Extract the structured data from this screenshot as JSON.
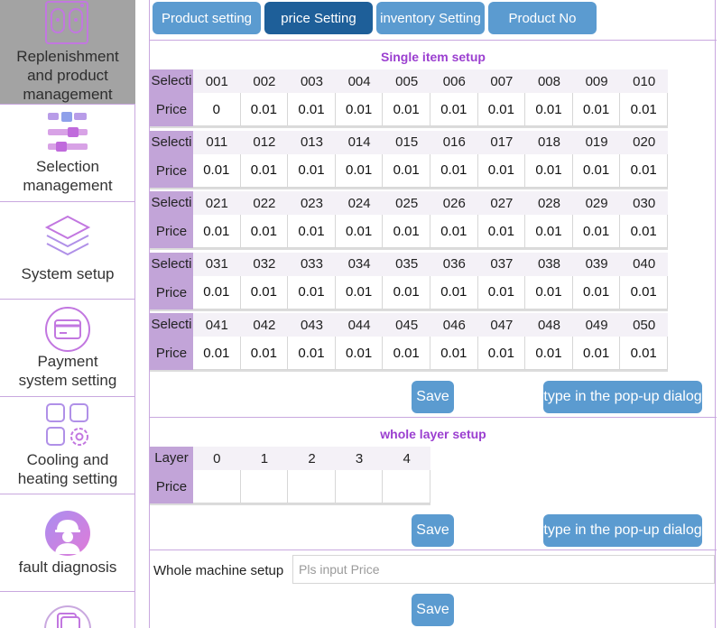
{
  "sidebar": {
    "items": [
      {
        "label_lines": [
          "Replenishment",
          "and product",
          "management"
        ],
        "icon": "cabinet-icon",
        "active": true
      },
      {
        "label_lines": [
          "Selection",
          "management"
        ],
        "icon": "sliders-icon",
        "active": false
      },
      {
        "label_lines": [
          "System setup"
        ],
        "icon": "layers-icon",
        "active": false
      },
      {
        "label_lines": [
          "Payment",
          "system setting"
        ],
        "icon": "card-icon",
        "active": false
      },
      {
        "label_lines": [
          "Cooling and",
          "heating setting"
        ],
        "icon": "grid-gear-icon",
        "active": false
      },
      {
        "label_lines": [
          "fault diagnosis"
        ],
        "icon": "worker-icon",
        "active": false
      },
      {
        "label_lines": [],
        "icon": "document-icon",
        "active": false
      }
    ]
  },
  "tabs": [
    {
      "label": "Product setting",
      "active": false
    },
    {
      "label": "price Setting",
      "active": true
    },
    {
      "label": "inventory Setting",
      "active": false
    },
    {
      "label": "Product No",
      "active": false
    }
  ],
  "single_item": {
    "title": "Single item setup",
    "selection_label": "Selecti",
    "price_label": "Price",
    "rows": [
      {
        "selections": [
          "001",
          "002",
          "003",
          "004",
          "005",
          "006",
          "007",
          "008",
          "009",
          "010"
        ],
        "prices": [
          "0",
          "0.01",
          "0.01",
          "0.01",
          "0.01",
          "0.01",
          "0.01",
          "0.01",
          "0.01",
          "0.01"
        ]
      },
      {
        "selections": [
          "011",
          "012",
          "013",
          "014",
          "015",
          "016",
          "017",
          "018",
          "019",
          "020"
        ],
        "prices": [
          "0.01",
          "0.01",
          "0.01",
          "0.01",
          "0.01",
          "0.01",
          "0.01",
          "0.01",
          "0.01",
          "0.01"
        ]
      },
      {
        "selections": [
          "021",
          "022",
          "023",
          "024",
          "025",
          "026",
          "027",
          "028",
          "029",
          "030"
        ],
        "prices": [
          "0.01",
          "0.01",
          "0.01",
          "0.01",
          "0.01",
          "0.01",
          "0.01",
          "0.01",
          "0.01",
          "0.01"
        ]
      },
      {
        "selections": [
          "031",
          "032",
          "033",
          "034",
          "035",
          "036",
          "037",
          "038",
          "039",
          "040"
        ],
        "prices": [
          "0.01",
          "0.01",
          "0.01",
          "0.01",
          "0.01",
          "0.01",
          "0.01",
          "0.01",
          "0.01",
          "0.01"
        ]
      },
      {
        "selections": [
          "041",
          "042",
          "043",
          "044",
          "045",
          "046",
          "047",
          "048",
          "049",
          "050"
        ],
        "prices": [
          "0.01",
          "0.01",
          "0.01",
          "0.01",
          "0.01",
          "0.01",
          "0.01",
          "0.01",
          "0.01",
          "0.01"
        ]
      }
    ],
    "save_label": "Save",
    "popup_label": "type in the pop-up dialog"
  },
  "whole_layer": {
    "title": "whole layer setup",
    "layer_label": "Layer",
    "price_label": "Price",
    "layers": [
      "0",
      "1",
      "2",
      "3",
      "4"
    ],
    "prices": [
      "",
      "",
      "",
      "",
      ""
    ],
    "save_label": "Save",
    "popup_label": "type in the pop-up dialog"
  },
  "whole_machine": {
    "label": "Whole machine setup",
    "placeholder": "Pls input Price",
    "value": "",
    "save_label": "Save"
  },
  "colors": {
    "accent": "#5b9bd0",
    "accent_active": "#1e5f99",
    "section_title": "#9b3fd0",
    "row_label_bg": "#c2a4d8",
    "sidebar_active_bg": "#a3a3a3"
  }
}
